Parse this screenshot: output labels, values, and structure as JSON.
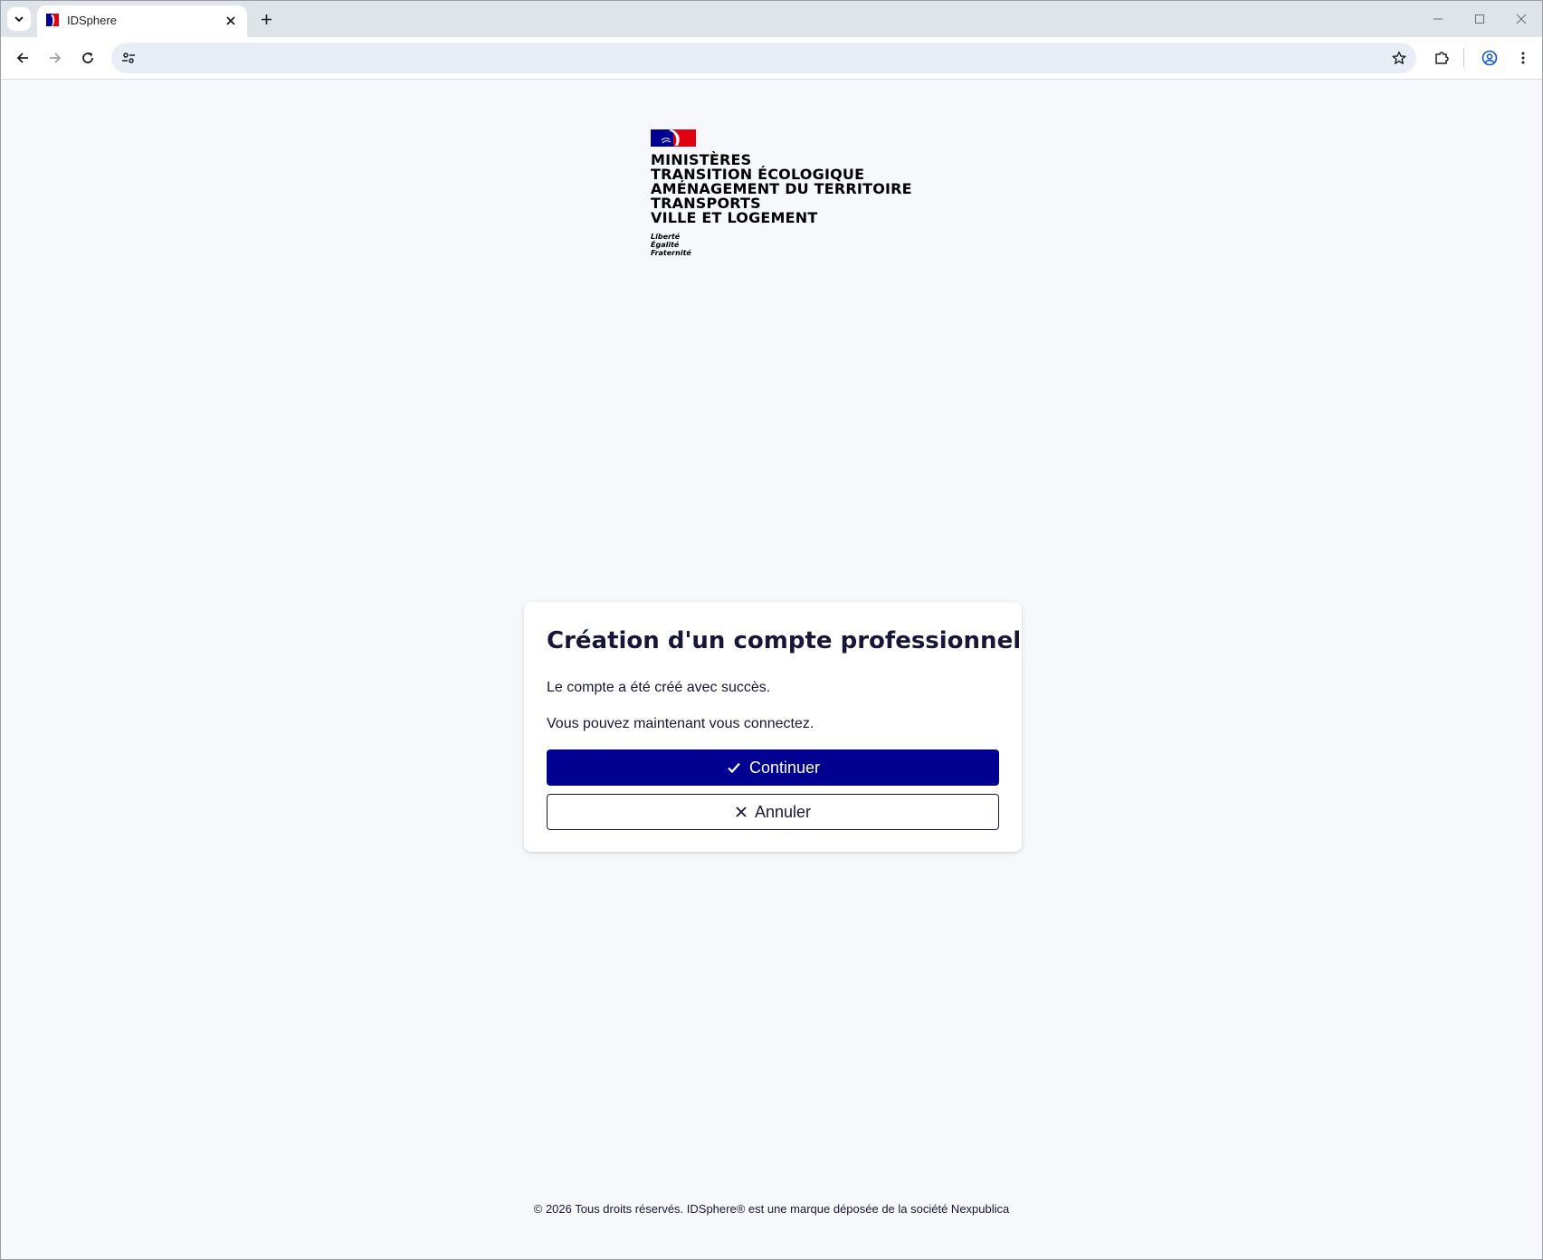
{
  "browser": {
    "tab_title": "IDSphere",
    "address": "",
    "icons": {
      "tab_menu": "chevron-down-icon",
      "tab_close": "close-icon",
      "new_tab": "plus-icon",
      "back": "arrow-left-icon",
      "forward": "arrow-right-icon",
      "reload": "reload-icon",
      "site_info": "tune-icon",
      "bookmark": "star-icon",
      "extensions": "puzzle-icon",
      "profile": "account-icon",
      "menu": "more-vert-icon"
    }
  },
  "header": {
    "logo_lines": [
      "MINISTÈRES",
      "TRANSITION ÉCOLOGIQUE",
      "AMÉNAGEMENT DU TERRITOIRE",
      "TRANSPORTS",
      "VILLE ET LOGEMENT"
    ],
    "motto": [
      "Liberté",
      "Égalité",
      "Fraternité"
    ]
  },
  "card": {
    "title": "Création d'un compte professionnel",
    "message_1": "Le compte a été créé avec succès.",
    "message_2": "Vous pouvez maintenant vous connectez.",
    "continue_label": "Continuer",
    "cancel_label": "Annuler"
  },
  "footer": {
    "text": "© 2026 Tous droits réservés. IDSphere® est une marque déposée de la société Nexpublica"
  },
  "colors": {
    "primary": "#000091",
    "text": "#161638",
    "page_bg": "#f6f8fc",
    "flag_blue": "#000091",
    "flag_red": "#e1000f"
  }
}
